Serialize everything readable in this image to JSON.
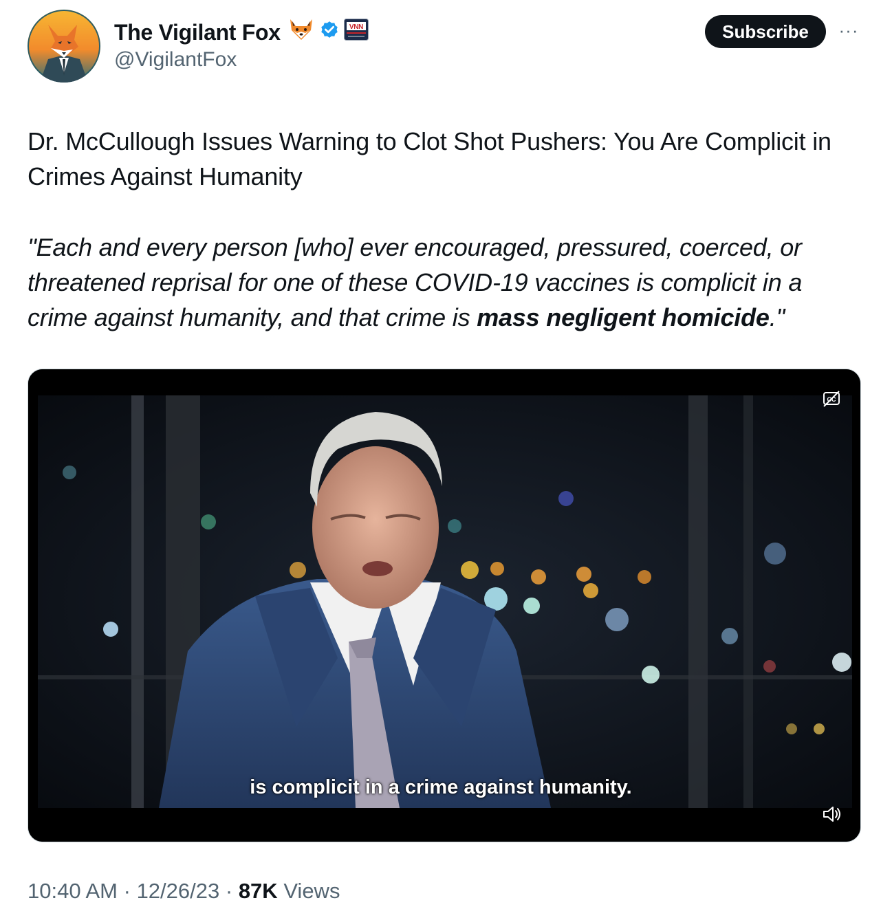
{
  "author": {
    "display_name": "The Vigilant Fox",
    "handle": "@VigilantFox",
    "icons": [
      "fox-emoji",
      "verified-badge-icon",
      "vnn-affiliate-logo"
    ],
    "badge_logo_text": "VNN"
  },
  "actions": {
    "subscribe_label": "Subscribe",
    "more_label": "···"
  },
  "tweet": {
    "headline": "Dr. McCullough Issues Warning to Clot Shot Pushers: You Are Complicit in Crimes Against Humanity",
    "quote_part1": "\"Each and every person [who] ever encouraged, pressured, coerced, or threatened reprisal for one of these COVID-19 vaccines is complicit in a crime against humanity, and that crime is ",
    "quote_bold": "mass negligent homicide",
    "quote_part2": ".\""
  },
  "video": {
    "caption": "is complicit in a crime against humanity.",
    "icons": [
      "closed-captions-off-icon",
      "volume-icon"
    ]
  },
  "meta": {
    "time": "10:40 AM",
    "date": "12/26/23",
    "separator": "·",
    "views_count": "87K",
    "views_label": "Views"
  },
  "colors": {
    "text_primary": "#0f1419",
    "text_secondary": "#536471",
    "verified_blue": "#1d9bf0",
    "button_bg": "#0f1419"
  }
}
